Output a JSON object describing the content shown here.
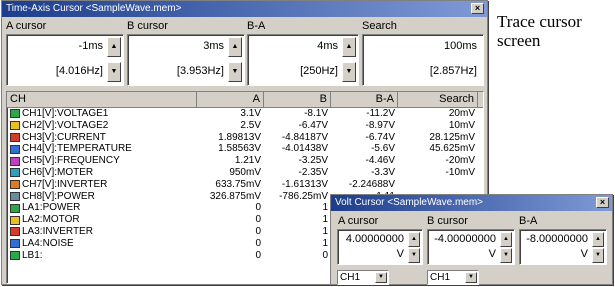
{
  "main_window": {
    "title": "Time-Axis Cursor <SampleWave.mem>",
    "close": "×",
    "labels": {
      "a": "A cursor",
      "b": "B cursor",
      "ba": "B-A",
      "search": "Search"
    },
    "a": {
      "value": "-1ms",
      "freq": "[4.016Hz]"
    },
    "b": {
      "value": "3ms",
      "freq": "[3.953Hz]"
    },
    "ba": {
      "value": "4ms",
      "freq": "[250Hz]"
    },
    "search": {
      "value": "100ms",
      "freq": "[2.857Hz]"
    },
    "columns": [
      "CH",
      "A",
      "B",
      "B-A",
      "Search"
    ],
    "rows": [
      {
        "name": "CH1[V]:VOLTAGE1",
        "a": "3.1V",
        "b": "-8.1V",
        "ba": "-11.2V",
        "search": "20mV",
        "color": "#2aa84a"
      },
      {
        "name": "CH2[V]:VOLTAGE2",
        "a": "2.5V",
        "b": "-6.47V",
        "ba": "-8.97V",
        "search": "10mV",
        "color": "#e8c020"
      },
      {
        "name": "CH3[V]:CURRENT",
        "a": "1.89813V",
        "b": "-4.84187V",
        "ba": "-6.74V",
        "search": "28.125mV",
        "color": "#d83a2a"
      },
      {
        "name": "CH4[V]:TEMPERATURE",
        "a": "1.58563V",
        "b": "-4.01438V",
        "ba": "-5.6V",
        "search": "45.625mV",
        "color": "#2f6fd6"
      },
      {
        "name": "CH5[V]:FREQUENCY",
        "a": "1.21V",
        "b": "-3.25V",
        "ba": "-4.46V",
        "search": "-20mV",
        "color": "#c040c0"
      },
      {
        "name": "CH6[V]:MOTER",
        "a": "950mV",
        "b": "-2.35V",
        "ba": "-3.3V",
        "search": "-10mV",
        "color": "#30a0c0"
      },
      {
        "name": "CH7[V]:INVERTER",
        "a": "633.75mV",
        "b": "-1.61313V",
        "ba": "-2.24688V",
        "search": "",
        "color": "#e07a20"
      },
      {
        "name": "CH8[V]:POWER",
        "a": "326.875mV",
        "b": "-786.25mV",
        "ba": "-1.11",
        "search": "",
        "color": "#6a8aa0"
      },
      {
        "name": "LA1:POWER",
        "a": "0",
        "b": "1",
        "ba": "",
        "search": "",
        "color": "#2aa84a"
      },
      {
        "name": "LA2:MOTOR",
        "a": "0",
        "b": "1",
        "ba": "",
        "search": "",
        "color": "#e8c020"
      },
      {
        "name": "LA3:INVERTER",
        "a": "0",
        "b": "1",
        "ba": "",
        "search": "",
        "color": "#d83a2a"
      },
      {
        "name": "LA4:NOISE",
        "a": "0",
        "b": "1",
        "ba": "",
        "search": "",
        "color": "#2f6fd6"
      },
      {
        "name": "LB1:",
        "a": "0",
        "b": "0",
        "ba": "",
        "search": "",
        "color": "#2aa84a"
      }
    ]
  },
  "volt_window": {
    "title": "Volt Cursor <SampleWave.mem>",
    "close": "×",
    "labels": {
      "a": "A cursor",
      "b": "B cursor",
      "ba": "B-A"
    },
    "a": {
      "value": "4.00000000",
      "unit": "V"
    },
    "b": {
      "value": "-4.00000000",
      "unit": "V"
    },
    "ba": {
      "value": "-8.00000000",
      "unit": "V"
    },
    "ch_a": "CH1",
    "ch_b": "CH1"
  },
  "caption": {
    "line1": "Trace cursor",
    "line2": "screen"
  }
}
